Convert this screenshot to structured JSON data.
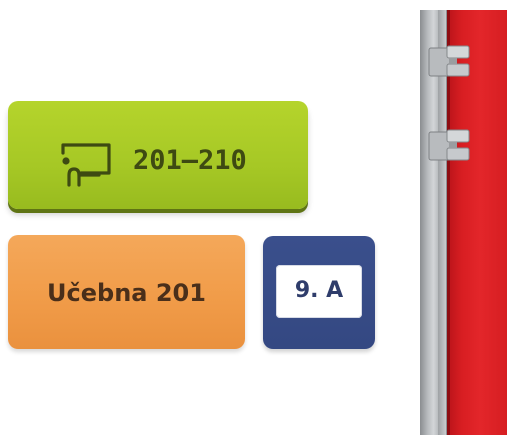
{
  "signs": {
    "green": {
      "label": "201–210",
      "icon": "teacher-at-board-icon",
      "color": "#a6c825"
    },
    "orange": {
      "label": "Učebna 201",
      "color": "#f19c49"
    },
    "blue": {
      "label": "9. A",
      "color": "#344882"
    }
  },
  "door": {
    "color": "#d81e22",
    "frame_color": "#b7babd",
    "hinges": [
      "door-hinge-icon",
      "door-hinge-icon"
    ]
  }
}
